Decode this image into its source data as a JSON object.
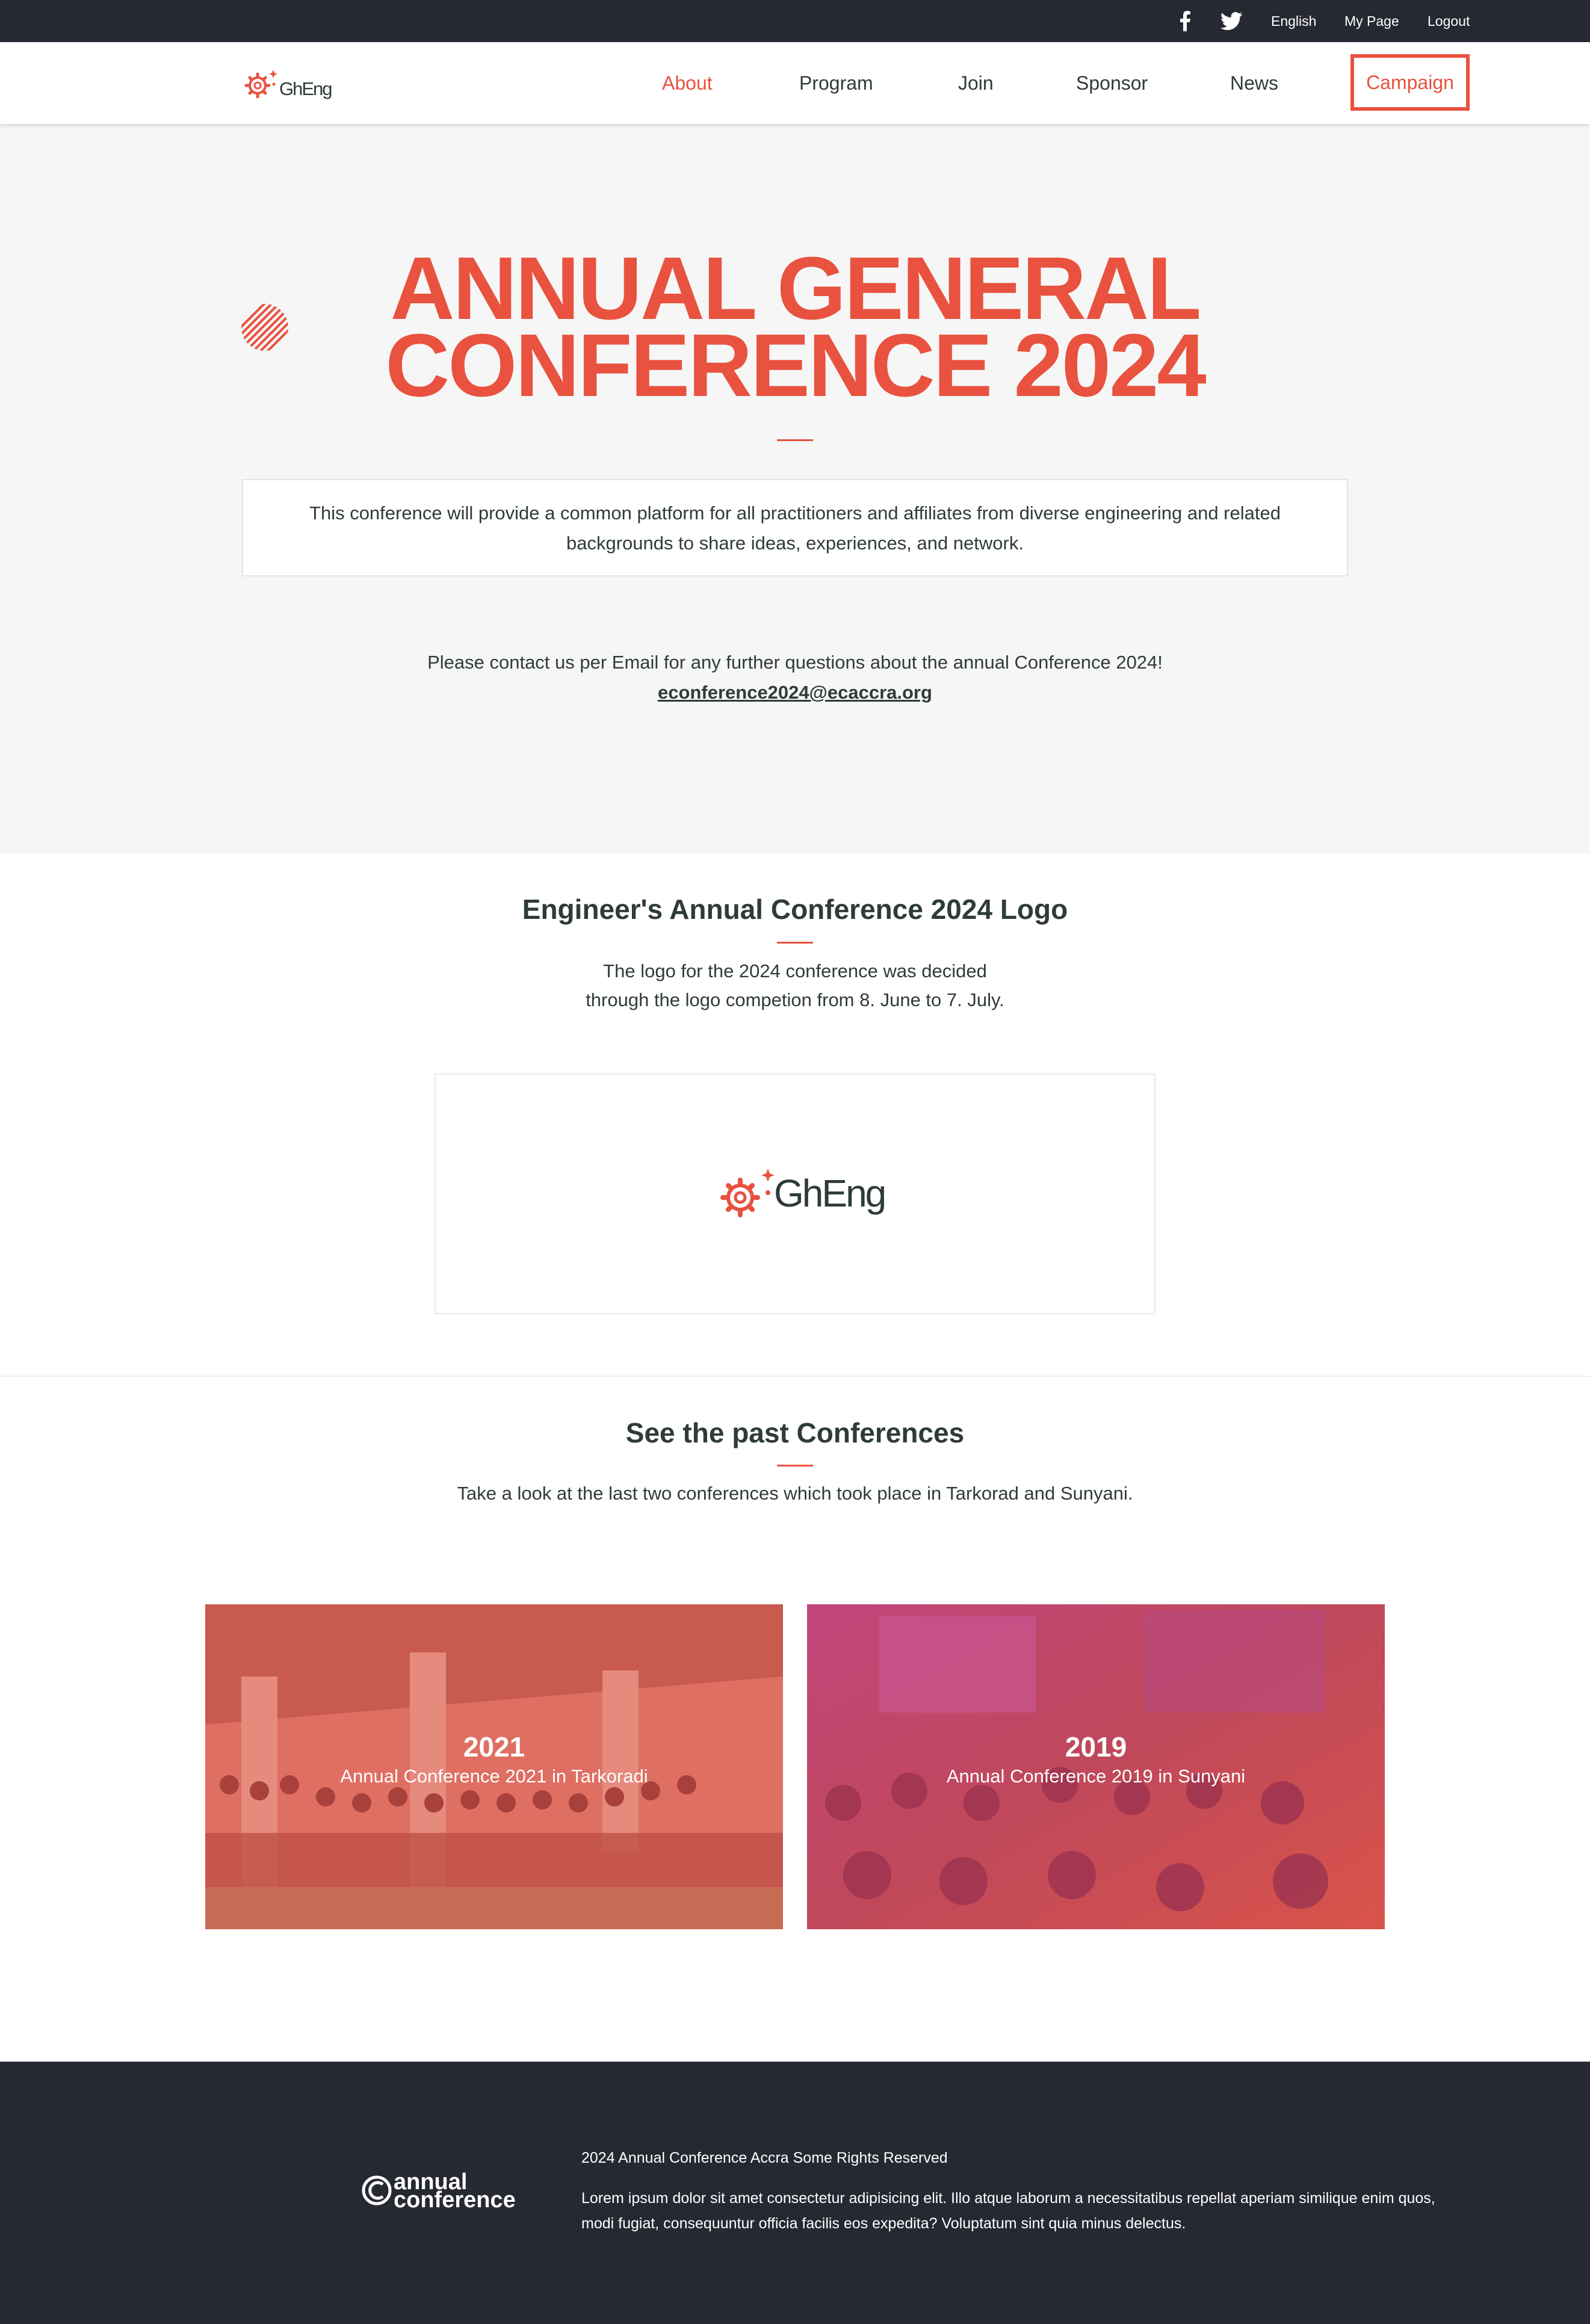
{
  "topbar": {
    "facebook_icon": "facebook-icon",
    "twitter_icon": "twitter-icon",
    "language": "English",
    "my_page": "My Page",
    "logout": "Logout"
  },
  "header": {
    "logo_text": "GhEng",
    "nav": {
      "about": "About",
      "program": "Program",
      "join": "Join",
      "sponsor": "Sponsor",
      "news": "News",
      "campaign": "Campaign"
    }
  },
  "hero": {
    "title_line1": "ANNUAL GENERAL",
    "title_line2": "CONFERENCE 2024",
    "description": "This conference will provide a common platform for all practitioners and affiliates from diverse engineering and related backgrounds to share ideas, experiences, and network.",
    "contact_text": "Please contact us per Email for any further questions about the annual Conference 2024!",
    "contact_email": "econference2024@ecaccra.org"
  },
  "logo_section": {
    "title": "Engineer's Annual Conference 2024 Logo",
    "text_line1": "The logo for the 2024 conference was decided",
    "text_line2": "through the logo competion from 8. June to 7. July.",
    "logo_text": "GhEng"
  },
  "past_section": {
    "title": "See the past Conferences",
    "text": "Take a look at the last two conferences which took place in Tarkorad and Sunyani.",
    "cards": [
      {
        "year": "2021",
        "subtitle": "Annual Conference 2021 in Tarkoradi"
      },
      {
        "year": "2019",
        "subtitle": "Annual Conference 2019 in Sunyani"
      }
    ]
  },
  "footer": {
    "logo_word1": "annual",
    "logo_word2": "conference",
    "rights": "2024 Annual Conference Accra Some Rights Reserved",
    "lorem": "Lorem ipsum dolor sit amet consectetur adipisicing elit. Illo atque laborum a necessitatibus repellat aperiam similique enim quos, modi fugiat, consequuntur officia facilis eos expedita? Voluptatum sint quia minus delectus."
  },
  "colors": {
    "accent": "#e8523f",
    "dark": "#262832",
    "text": "#2f3b3a",
    "hero_bg": "#f6f6f6"
  }
}
